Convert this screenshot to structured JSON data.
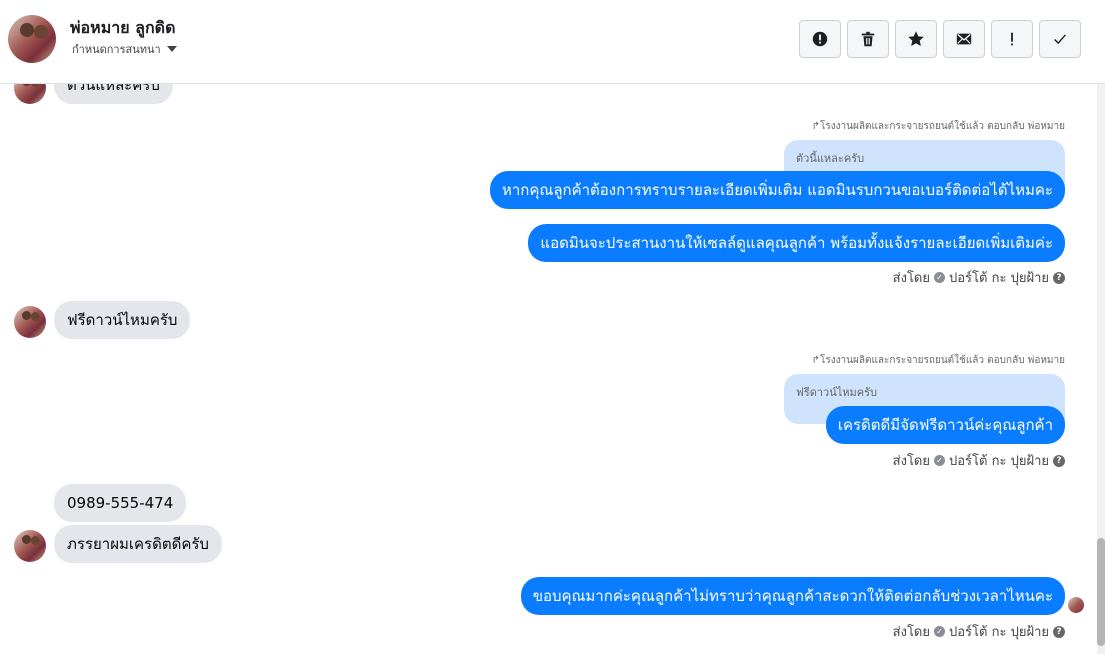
{
  "header": {
    "contact_name": "พ่อหมาย ลูกดิด",
    "subtitle": "กำหนดการสนทนา",
    "tools": [
      {
        "icon": "alert-circle-icon"
      },
      {
        "icon": "trash-icon"
      },
      {
        "icon": "star-icon"
      },
      {
        "icon": "envelope-icon"
      },
      {
        "icon": "exclamation-icon"
      },
      {
        "icon": "check-icon"
      }
    ]
  },
  "messages": {
    "m0_in_cut": "ตัวนี้แหละครับ",
    "m1_reply_meta": "โรงงานผลิตและกระจายรถยนต์ใช้แล้ว ตอบกลับ พ่อหมาย",
    "m1_quote": "ตัวนี้แหละครับ",
    "m1_text": "หากคุณลูกค้าต้องการทราบรายละเอียดเพิ่มเติม  แอดมินรบกวนขอเบอร์ติดต่อได้ไหมคะ",
    "m2_text": "แอดมินจะประสานงานให้เซลล์ดูแลคุณลูกค้า พร้อมทั้งแจ้งรายละเอียดเพิ่มเติมค่ะ",
    "sent_by_1": "ส่งโดย",
    "sender_1": "ปอร์โต้ กะ ปุยฝ้าย",
    "m3_in": "ฟรีดาวน์ไหมครับ",
    "m4_reply_meta": "โรงงานผลิตและกระจายรถยนต์ใช้แล้ว ตอบกลับ พ่อหมาย",
    "m4_quote": "ฟรีดาวน์ไหมครับ",
    "m4_text": "เครดิตดีมีจัดฟรีดาวน์ค่ะคุณลูกค้า",
    "sent_by_2": "ส่งโดย",
    "sender_2": "ปอร์โต้ กะ ปุยฝ้าย",
    "m5_in_phone": "0989-555-474",
    "m6_in": "ภรรยาผมเครดิตดีครับ",
    "m7_text": "ขอบคุณมากค่ะคุณลูกค้าไม่ทราบว่าคุณลูกค้าสะดวกให้ติดต่อกลับช่วงเวลาไหนคะ",
    "sent_by_3": "ส่งโดย",
    "sender_3": "ปอร์โต้ กะ ปุยฝ้าย"
  },
  "colors": {
    "outgoing_bubble": "#0a7cff",
    "incoming_bubble": "#e4e6eb",
    "quote_bubble": "#cfe3fc"
  }
}
